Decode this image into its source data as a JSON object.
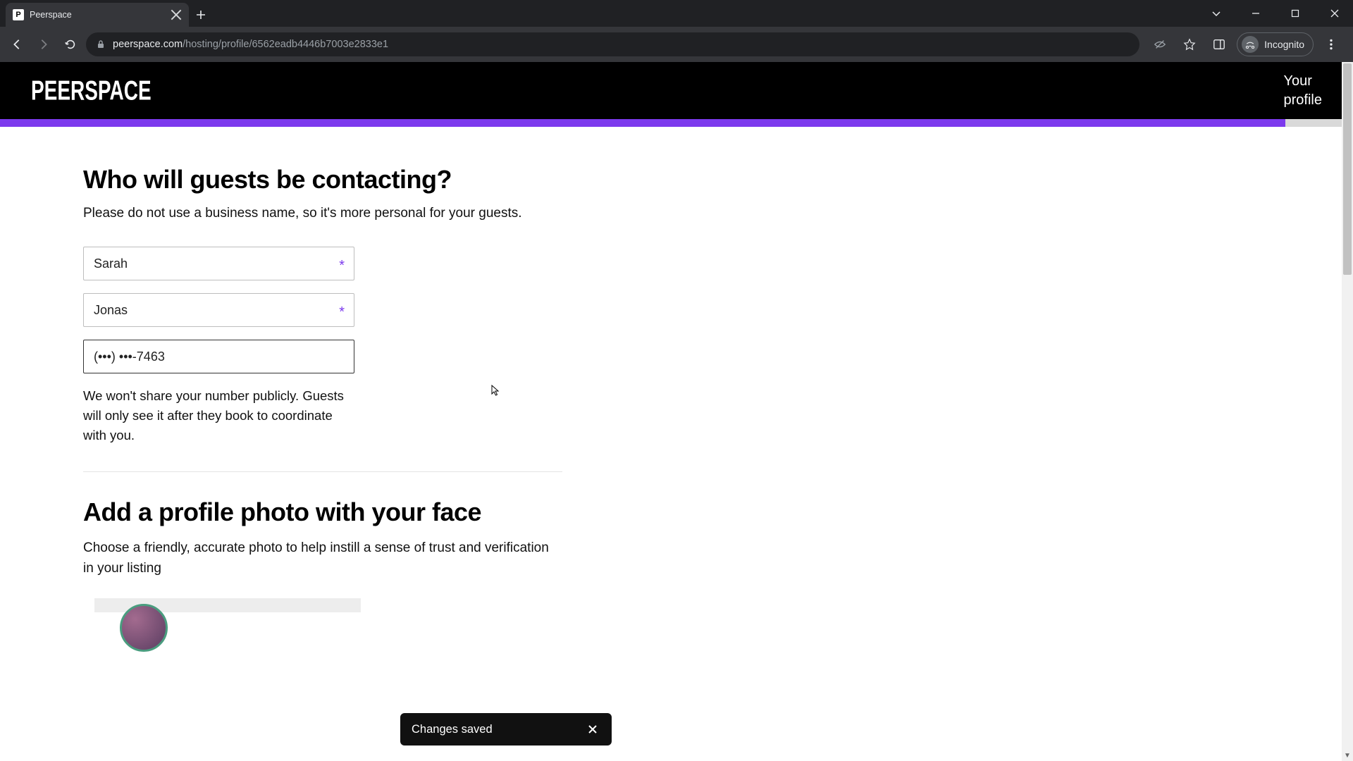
{
  "browser": {
    "tab_title": "Peerspace",
    "favicon_letter": "P",
    "url_domain": "peerspace.com",
    "url_path": "/hosting/profile/6562eadb4446b7003e2833e1",
    "incognito_label": "Incognito"
  },
  "header": {
    "logo_text": "PEERSPACE",
    "profile_link_line1": "Your",
    "profile_link_line2": "profile"
  },
  "progress": {
    "percent": 95,
    "accent": "#7c3aed"
  },
  "contact_section": {
    "heading": "Who will guests be contacting?",
    "subtitle": "Please do not use a business name, so it's more personal for your guests.",
    "first_name": "Sarah",
    "last_name": "Jonas",
    "phone": "(•••) •••-7463",
    "phone_help": "We won't share your number publicly. Guests will only see it after they book to coordinate with you."
  },
  "photo_section": {
    "heading": "Add a profile photo with your face",
    "subtitle": "Choose a friendly, accurate photo to help instill a sense of trust and verification in your listing"
  },
  "toast": {
    "message": "Changes saved"
  }
}
